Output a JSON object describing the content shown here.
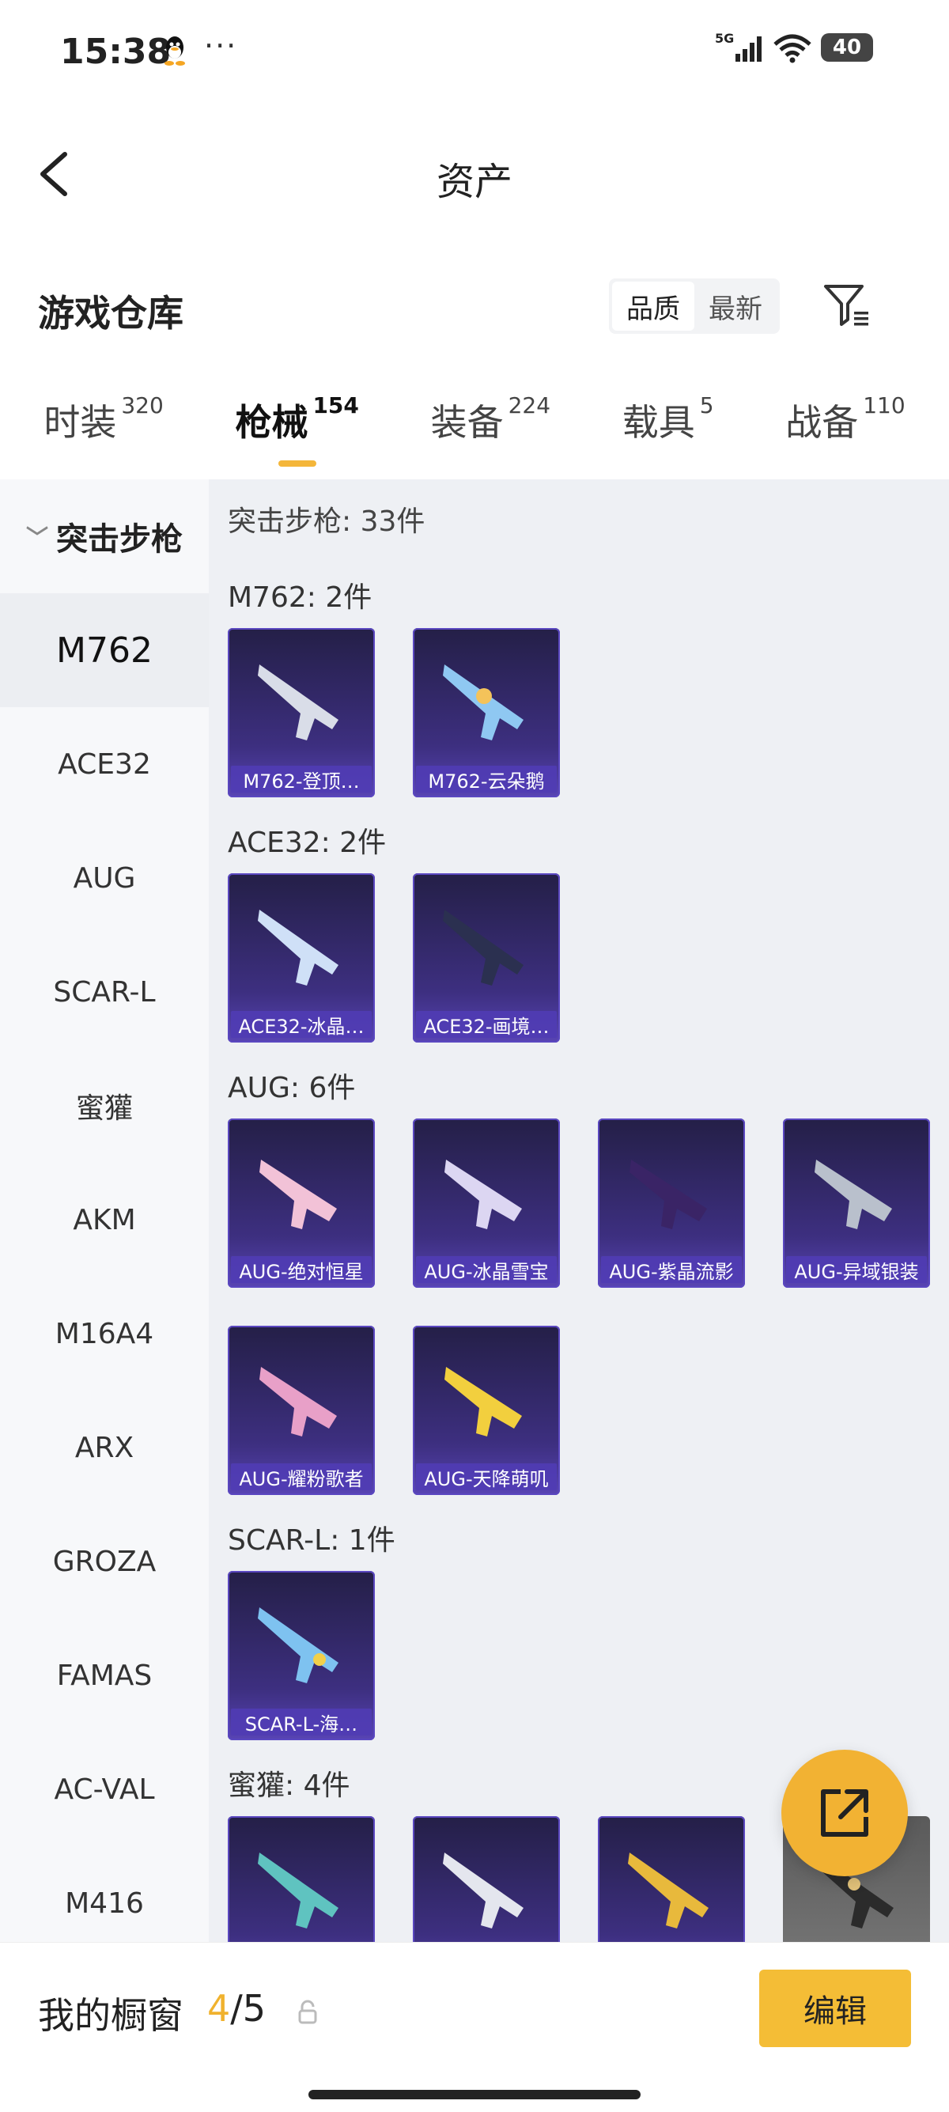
{
  "status_bar": {
    "time": "15:38",
    "more": "···",
    "network": "5G",
    "battery": "40"
  },
  "header": {
    "title": "资产"
  },
  "warehouse": {
    "title": "游戏仓库",
    "sort_options": [
      "品质",
      "最新"
    ],
    "sort_selected": "品质"
  },
  "tabs": [
    {
      "label": "时装",
      "count": "320"
    },
    {
      "label": "枪械",
      "count": "154",
      "active": true
    },
    {
      "label": "装备",
      "count": "224"
    },
    {
      "label": "载具",
      "count": "5"
    },
    {
      "label": "战备",
      "count": "110"
    }
  ],
  "sidebar": {
    "category": "突击步枪",
    "items": [
      "M762",
      "ACE32",
      "AUG",
      "SCAR-L",
      "蜜獾",
      "AKM",
      "M16A4",
      "ARX",
      "GROZA",
      "FAMAS",
      "AC-VAL",
      "M416"
    ],
    "selected": "M762"
  },
  "content": {
    "summary": "突击步枪: 33件",
    "groups": [
      {
        "title": "M762: 2件",
        "items": [
          "M762-登顶…",
          "M762-云朵鹅"
        ]
      },
      {
        "title": "ACE32: 2件",
        "items": [
          "ACE32-冰晶…",
          "ACE32-画境…"
        ]
      },
      {
        "title": "AUG: 6件",
        "items": [
          "AUG-绝对恒星",
          "AUG-冰晶雪宝",
          "AUG-紫晶流影",
          "AUG-异域银装",
          "AUG-耀粉歌者",
          "AUG-天降萌叽"
        ]
      },
      {
        "title": "SCAR-L: 1件",
        "items": [
          "SCAR-L-海…"
        ]
      },
      {
        "title": "蜜獾: 4件",
        "items": [
          "",
          "",
          "",
          ""
        ]
      }
    ]
  },
  "bottom_bar": {
    "label": "我的橱窗",
    "count_current": "4",
    "count_sep": "/",
    "count_total": "5",
    "edit_label": "编辑"
  },
  "colors": {
    "accent": "#f4bd36",
    "card_bg": "#3d2f80",
    "sidebar_bg": "#f7f8fa",
    "content_bg": "#eef0f4"
  }
}
